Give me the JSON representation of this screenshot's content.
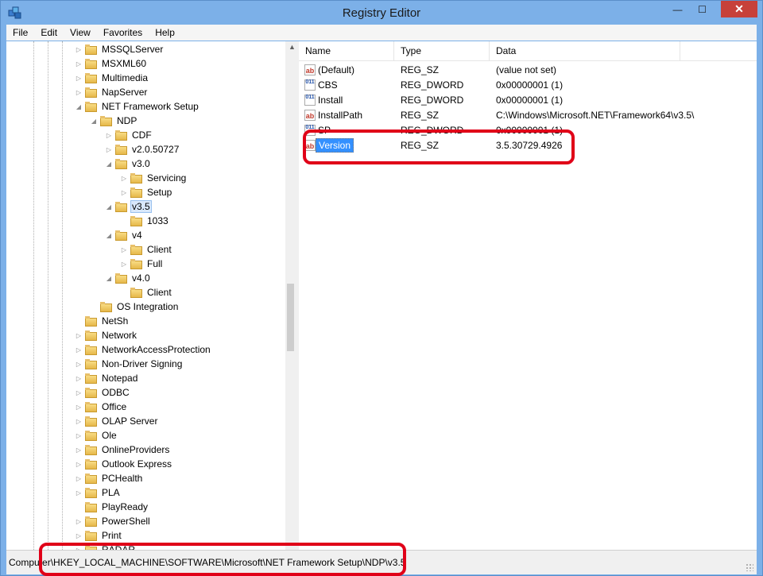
{
  "window": {
    "title": "Registry Editor",
    "close_glyph": "✕",
    "min_glyph": "—",
    "max_glyph": "☐"
  },
  "menu": [
    "File",
    "Edit",
    "View",
    "Favorites",
    "Help"
  ],
  "tree": [
    {
      "label": "MSSQLServer"
    },
    {
      "label": "MSXML60"
    },
    {
      "label": "Multimedia"
    },
    {
      "label": "NapServer"
    },
    {
      "label": "NET Framework Setup"
    },
    {
      "label": "NDP"
    },
    {
      "label": "CDF"
    },
    {
      "label": "v2.0.50727"
    },
    {
      "label": "v3.0"
    },
    {
      "label": "Servicing"
    },
    {
      "label": "Setup"
    },
    {
      "label": "v3.5"
    },
    {
      "label": "1033"
    },
    {
      "label": "v4"
    },
    {
      "label": "Client"
    },
    {
      "label": "Full"
    },
    {
      "label": "v4.0"
    },
    {
      "label": "Client"
    },
    {
      "label": "OS Integration"
    },
    {
      "label": "NetSh"
    },
    {
      "label": "Network"
    },
    {
      "label": "NetworkAccessProtection"
    },
    {
      "label": "Non-Driver Signing"
    },
    {
      "label": "Notepad"
    },
    {
      "label": "ODBC"
    },
    {
      "label": "Office"
    },
    {
      "label": "OLAP Server"
    },
    {
      "label": "Ole"
    },
    {
      "label": "OnlineProviders"
    },
    {
      "label": "Outlook Express"
    },
    {
      "label": "PCHealth"
    },
    {
      "label": "PLA"
    },
    {
      "label": "PlayReady"
    },
    {
      "label": "PowerShell"
    },
    {
      "label": "Print"
    },
    {
      "label": "RADAR"
    }
  ],
  "columns": {
    "name": "Name",
    "type": "Type",
    "data": "Data"
  },
  "values": [
    {
      "name": "(Default)",
      "type": "REG_SZ",
      "data": "(value not set)",
      "icon": "ab"
    },
    {
      "name": "CBS",
      "type": "REG_DWORD",
      "data": "0x00000001 (1)",
      "icon": "011"
    },
    {
      "name": "Install",
      "type": "REG_DWORD",
      "data": "0x00000001 (1)",
      "icon": "011"
    },
    {
      "name": "InstallPath",
      "type": "REG_SZ",
      "data": "C:\\Windows\\Microsoft.NET\\Framework64\\v3.5\\",
      "icon": "ab"
    },
    {
      "name": "SP",
      "type": "REG_DWORD",
      "data": "0x00000001 (1)",
      "icon": "011"
    },
    {
      "name": "Version",
      "type": "REG_SZ",
      "data": "3.5.30729.4926",
      "icon": "ab"
    }
  ],
  "status": {
    "path": "Computer\\HKEY_LOCAL_MACHINE\\SOFTWARE\\Microsoft\\NET Framework Setup\\NDP\\v3.5"
  },
  "colors": {
    "highlight": "#e00018",
    "selection": "#3390ff"
  }
}
